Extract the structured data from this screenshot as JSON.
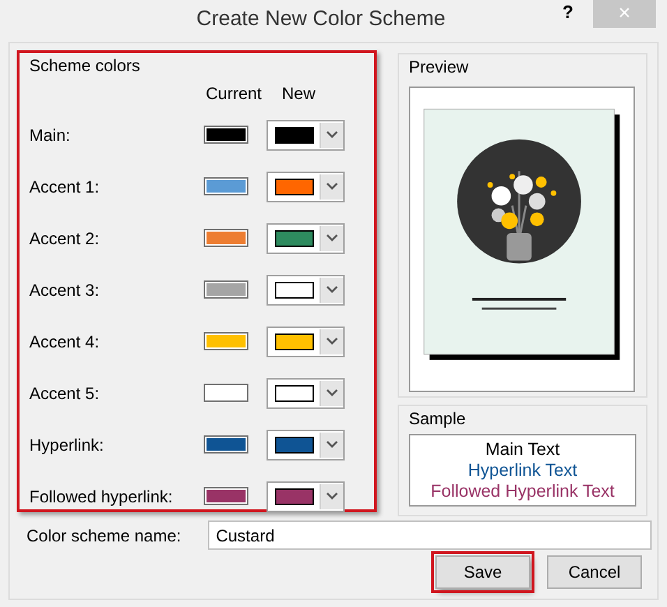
{
  "window": {
    "title": "Create New Color Scheme",
    "help_glyph": "?",
    "close_glyph": "×"
  },
  "scheme_colors": {
    "title": "Scheme colors",
    "highlighted": true,
    "column_headers": [
      "Current",
      "New"
    ],
    "rows": [
      {
        "label": "Main:",
        "current": {
          "color": "#000000"
        },
        "new": {
          "color": "#000000"
        }
      },
      {
        "label": "Accent 1:",
        "current": {
          "color": "#5b9bd5"
        },
        "new": {
          "color": "#ff6600"
        }
      },
      {
        "label": "Accent 2:",
        "current": {
          "color": "#ed7d31"
        },
        "new": {
          "color": "#2e8b5f"
        }
      },
      {
        "label": "Accent 3:",
        "current": {
          "color": "#a5a5a5"
        },
        "new": {
          "color": "#ffffff"
        }
      },
      {
        "label": "Accent 4:",
        "current": {
          "color": "#ffc000"
        },
        "new": {
          "color": "#ffc000"
        }
      },
      {
        "label": "Accent 5:",
        "current": {
          "color": "#ffffff"
        },
        "new": {
          "color": "#ffffff"
        }
      },
      {
        "label": "Hyperlink:",
        "current": {
          "color": "#0f5494"
        },
        "new": {
          "color": "#0f5494"
        }
      },
      {
        "label": "Followed hyperlink:",
        "current": {
          "color": "#993366"
        },
        "new": {
          "color": "#993366"
        }
      }
    ]
  },
  "preview": {
    "title": "Preview"
  },
  "sample": {
    "title": "Sample",
    "main_text": "Main Text",
    "hyperlink_text": "Hyperlink Text",
    "followed_hyperlink_text": "Followed Hyperlink Text"
  },
  "name_field": {
    "label": "Color scheme name:",
    "value": "Custard"
  },
  "buttons": [
    {
      "label": "Save",
      "highlighted": true
    },
    {
      "label": "Cancel",
      "highlighted": false
    }
  ]
}
